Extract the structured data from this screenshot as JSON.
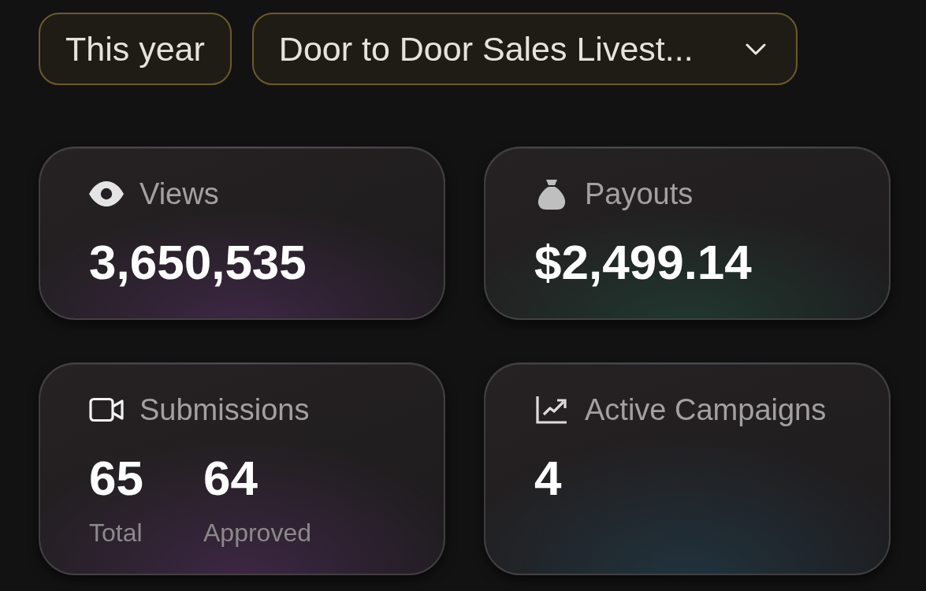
{
  "filters": {
    "period": {
      "label": "This year"
    },
    "campaign": {
      "value": "Door to Door Sales Livest..."
    }
  },
  "stats": [
    {
      "kind": "single",
      "label": "Views",
      "value": "3,650,535"
    },
    {
      "kind": "single",
      "label": "Payouts",
      "value": "$2,499.14"
    },
    {
      "kind": "split",
      "label": "Submissions",
      "metrics": [
        {
          "value": "65",
          "caption": "Total"
        },
        {
          "value": "64",
          "caption": "Approved"
        }
      ]
    },
    {
      "kind": "single",
      "label": "Active Campaigns",
      "value": "4"
    }
  ]
}
